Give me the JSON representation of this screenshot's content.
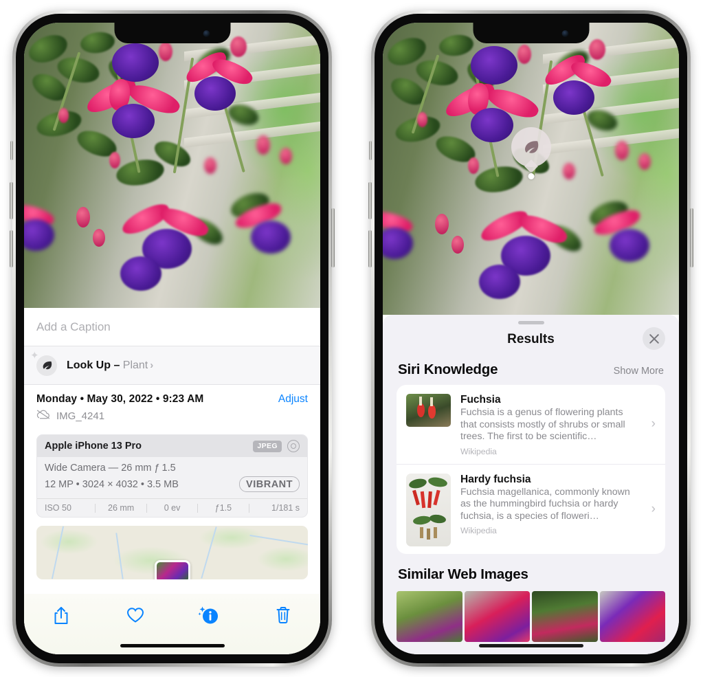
{
  "left_phone": {
    "caption_placeholder": "Add a Caption",
    "lookup": {
      "label_bold": "Look Up – ",
      "label_plain": "Plant",
      "chevron": "›",
      "icon": "leaf-icon"
    },
    "meta": {
      "date": "Monday • May 30, 2022 • 9:23 AM",
      "adjust": "Adjust",
      "filename": "IMG_4241",
      "cloud_icon": "icloud-slash-icon"
    },
    "camera_card": {
      "device": "Apple iPhone 13 Pro",
      "format_badge": "JPEG",
      "hdr_icon": "hdr-ring-icon",
      "lens_line": "Wide Camera — 26 mm ƒ 1.5",
      "size_line": "12 MP • 3024 × 4032 • 3.5 MB",
      "style_badge": "VIBRANT",
      "exif": [
        "ISO 50",
        "26 mm",
        "0 ev",
        "ƒ1.5",
        "1/181 s"
      ]
    },
    "toolbar": [
      {
        "name": "share-button",
        "icon": "share-icon"
      },
      {
        "name": "favorite-button",
        "icon": "heart-icon"
      },
      {
        "name": "info-button",
        "icon": "info-sparkle-icon"
      },
      {
        "name": "delete-button",
        "icon": "trash-icon"
      }
    ]
  },
  "right_phone": {
    "badge": {
      "icon": "leaf-icon"
    },
    "sheet": {
      "title": "Results",
      "close_icon": "close-icon"
    },
    "siri_knowledge": {
      "heading": "Siri Knowledge",
      "show_more": "Show More",
      "items": [
        {
          "title": "Fuchsia",
          "description": "Fuchsia is a genus of flowering plants that consists mostly of shrubs or small trees. The first to be scientific…",
          "source": "Wikipedia",
          "chevron": "›"
        },
        {
          "title": "Hardy fuchsia",
          "description": "Fuchsia magellanica, commonly known as the hummingbird fuchsia or hardy fuchsia, is a species of floweri…",
          "source": "Wikipedia",
          "chevron": "›"
        }
      ]
    },
    "similar_web_images": {
      "heading": "Similar Web Images",
      "count": 4
    }
  },
  "colors": {
    "accent_blue": "#0a84ff",
    "sheet_bg": "#f2f1f6",
    "card_bg": "#ffffff",
    "secondary_text": "#8e8e93"
  }
}
